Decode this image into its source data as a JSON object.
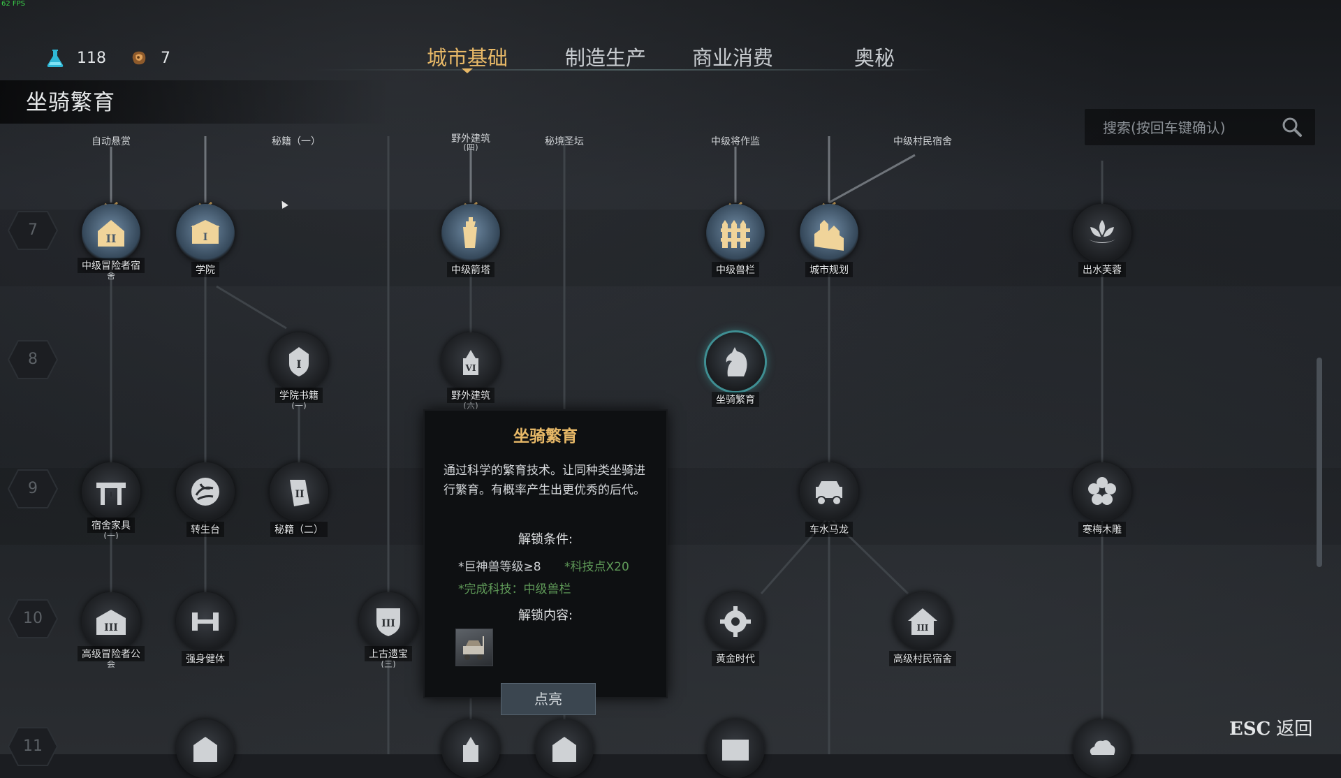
{
  "fps": "62 FPS",
  "resources": {
    "flask": {
      "value": "118",
      "icon": "flask-icon"
    },
    "ore": {
      "value": "7",
      "icon": "ore-icon"
    }
  },
  "page_title": "坐骑繁育",
  "tabs": [
    {
      "label": "城市基础",
      "active": true
    },
    {
      "label": "制造生产",
      "active": false
    },
    {
      "label": "商业消费",
      "active": false
    },
    {
      "label": "奥秘",
      "active": false
    }
  ],
  "search": {
    "placeholder": "搜索(按回车键确认)"
  },
  "rows": [
    "7",
    "8",
    "9",
    "10",
    "11"
  ],
  "top_labels": [
    "自动悬赏",
    "秘籍（一）",
    "野外建筑",
    "秘境圣坛",
    "中级将作监",
    "中级村民宿舍"
  ],
  "top_labels_sub": [
    "(四)"
  ],
  "nodes": {
    "mid_adventurer": {
      "label": "中级冒险者宿",
      "sub": "舍"
    },
    "academy": {
      "label": "学院"
    },
    "mid_arrow_tower": {
      "label": "中级箭塔"
    },
    "mid_pen": {
      "label": "中级兽栏"
    },
    "city_plan": {
      "label": "城市规划"
    },
    "lotus": {
      "label": "出水芙蓉"
    },
    "academy_book": {
      "label": "学院书籍",
      "sub": "(一)"
    },
    "wild_building": {
      "label": "野外建筑",
      "sub": "(六)"
    },
    "mount_breeding": {
      "label": "坐骑繁育"
    },
    "dorm_furniture": {
      "label": "宿舍家具",
      "sub": "(一)"
    },
    "rebirth_altar": {
      "label": "转生台"
    },
    "secret_book2": {
      "label": "秘籍（二）"
    },
    "traffic": {
      "label": "车水马龙"
    },
    "plum_carving": {
      "label": "寒梅木雕"
    },
    "high_adventurer": {
      "label": "高级冒险者公",
      "sub": "会"
    },
    "fitness": {
      "label": "强身健体"
    },
    "ancient_relic": {
      "label": "上古遗宝",
      "sub": "(三)"
    },
    "golden_age": {
      "label": "黄金时代"
    },
    "high_villager": {
      "label": "高级村民宿舍"
    }
  },
  "tooltip": {
    "title": "坐骑繁育",
    "description": "通过科学的繁育技术。让同种类坐骑进行繁育。有概率产生出更优秀的后代。",
    "unlock_conditions_label": "解锁条件:",
    "requirements": [
      "*巨神兽等级≥8",
      "*科技点X20",
      "*完成科技：中级兽栏"
    ],
    "unlock_content_label": "解锁内容:",
    "unlock_item_icon": "carriage-icon"
  },
  "unlock_button": "点亮",
  "esc": {
    "key": "ESC",
    "label": "返回"
  },
  "colors": {
    "accent_gold": "#e7b867",
    "requirement_green": "#5f9a58",
    "selected_ring": "#3f8f93"
  }
}
